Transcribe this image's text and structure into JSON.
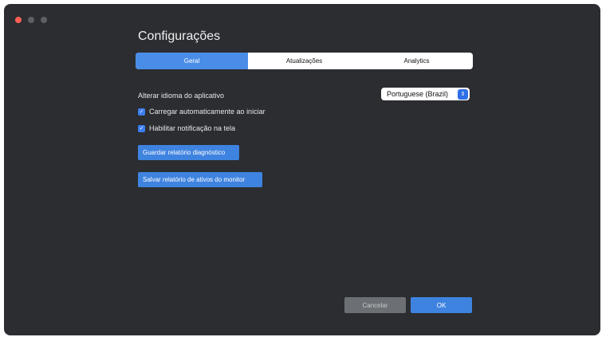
{
  "window": {
    "title": "Configurações"
  },
  "tabs": [
    {
      "label": "Geral",
      "active": true
    },
    {
      "label": "Atualizações",
      "active": false
    },
    {
      "label": "Analytics",
      "active": false
    }
  ],
  "general": {
    "language_label": "Alterar idioma do aplicativo",
    "language_value": "Portuguese (Brazil)",
    "autoload_label": "Carregar automaticamente ao iniciar",
    "autoload_checked": true,
    "notify_label": "Habilitar notificação na tela",
    "notify_checked": true,
    "diag_button": "Guardar relatório diagnóstico",
    "assets_button": "Salvar relatório de ativos do monitor"
  },
  "footer": {
    "cancel": "Cancelar",
    "ok": "OK"
  },
  "colors": {
    "accent": "#3f83e0",
    "background": "#2b2d30"
  }
}
